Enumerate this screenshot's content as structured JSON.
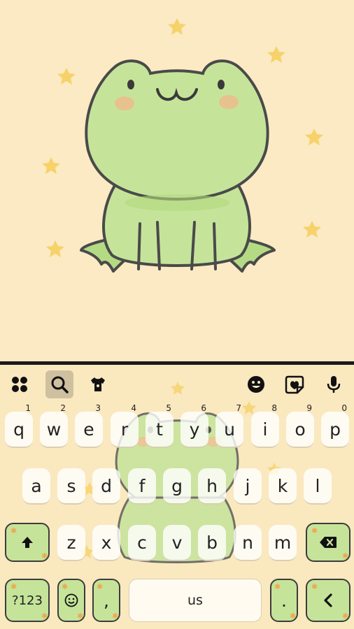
{
  "theme": {
    "background": "#fbeac3",
    "frog_body": "#c5e49a",
    "frog_outline": "#4a4a4a",
    "star_color": "#f7d26a",
    "func_key": "#c5e49a"
  },
  "toolbar": {
    "items": [
      {
        "name": "apps-icon",
        "active": false
      },
      {
        "name": "search-icon",
        "active": true
      },
      {
        "name": "theme-shirt-icon",
        "active": false
      },
      {
        "name": "emoji-sticker-icon",
        "active": false
      },
      {
        "name": "sticker-icon",
        "active": false
      },
      {
        "name": "microphone-icon",
        "active": false
      }
    ]
  },
  "keyboard": {
    "row1": [
      {
        "label": "q",
        "hint": "1"
      },
      {
        "label": "w",
        "hint": "2"
      },
      {
        "label": "e",
        "hint": "3"
      },
      {
        "label": "r",
        "hint": "4"
      },
      {
        "label": "t",
        "hint": "5"
      },
      {
        "label": "y",
        "hint": "6"
      },
      {
        "label": "u",
        "hint": "7"
      },
      {
        "label": "i",
        "hint": "8"
      },
      {
        "label": "o",
        "hint": "9"
      },
      {
        "label": "p",
        "hint": "0"
      }
    ],
    "row2": [
      "a",
      "s",
      "d",
      "f",
      "g",
      "h",
      "j",
      "k",
      "l"
    ],
    "row3": [
      "z",
      "x",
      "c",
      "v",
      "b",
      "n",
      "m"
    ],
    "symbols_label": "?123",
    "comma_label": ",",
    "space_label": "us",
    "period_label": ".",
    "shift_icon": "shift-arrow-icon",
    "backspace_icon": "backspace-icon",
    "enter_icon": "enter-arrow-icon",
    "emoji_icon": "emoji-icon"
  }
}
